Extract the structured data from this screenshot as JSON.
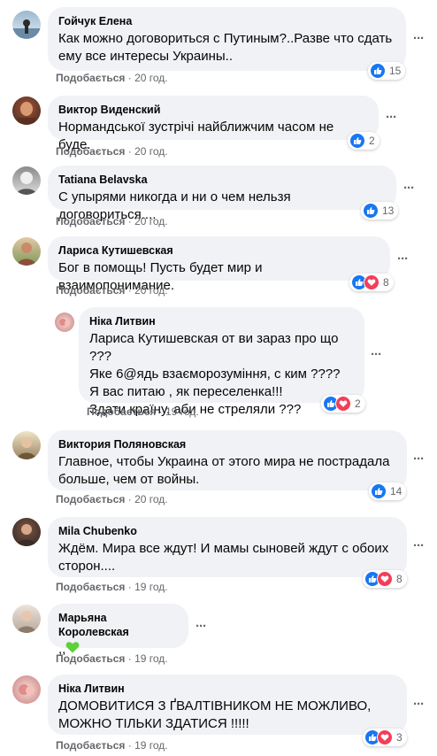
{
  "like_label": "Подобається",
  "comments": [
    {
      "author": "Гойчук Елена",
      "text": "Как можно договориться с Путиным?..Разве что сдать\nему все интересы Украины..",
      "time": "20 год.",
      "reaction_count": "15",
      "reactions": [
        "like"
      ],
      "avatar_colors": [
        "#9bb7cf",
        "#e6eef4"
      ]
    },
    {
      "author": "Виктор Виденский",
      "text": "Нормандської зустрічі найближчим часом не буде.",
      "time": "20 год.",
      "reaction_count": "2",
      "reactions": [
        "like"
      ],
      "avatar_colors": [
        "#a5523a",
        "#3c2a1c"
      ]
    },
    {
      "author": "Tatiana Belavska",
      "text": "С упырями никогда и ни о чем нельзя договориться....",
      "time": "20 год.",
      "reaction_count": "13",
      "reactions": [
        "like"
      ],
      "avatar_colors": [
        "#8a8a8a",
        "#dcdcdc"
      ]
    },
    {
      "author": "Лариса Кутишевская",
      "text": "Бог в помощь! Пусть будет мир и взаимопонимание.",
      "time": "20 год.",
      "reaction_count": "8",
      "reactions": [
        "like",
        "love"
      ],
      "avatar_colors": [
        "#c98b6a",
        "#5a7a3a"
      ]
    },
    {
      "author": "Ніка Литвин",
      "text": "Лариса Кутишевская от ви зараз про що ???\nЯке 6@ядь взаєморозуміння, с ким ????\nЯ вас питаю , як переселенка!!!\nЗдати країну, аби не стреляли ???",
      "time": "19 год.",
      "reaction_count": "2",
      "reactions": [
        "like",
        "love"
      ],
      "avatar_colors": [
        "#f2d6d0",
        "#c97d7d"
      ]
    },
    {
      "author": "Виктория Поляновская",
      "text": "Главное, чтобы Украина от этого мира не пострадала\nбольше, чем от войны.",
      "time": "20 год.",
      "reaction_count": "14",
      "reactions": [
        "like"
      ],
      "avatar_colors": [
        "#d9c9a8",
        "#7f6a4e"
      ]
    },
    {
      "author": "Mila  Chubenko",
      "text": "Ждём. Мира все ждут! И мамы сыновей ждут с обоих\nсторон....",
      "time": "19 год.",
      "reaction_count": "8",
      "reactions": [
        "like",
        "love"
      ],
      "avatar_colors": [
        "#6e4b3a",
        "#2e2420"
      ]
    },
    {
      "author": "Марьяна Королевская",
      "text": ",,",
      "heart": "💚",
      "time": "19 год.",
      "reaction_count": "",
      "reactions": [],
      "avatar_colors": [
        "#b8a89a",
        "#ece3dc"
      ]
    },
    {
      "author": "Ніка Литвин",
      "text": "ДОМОВИТИСЯ З ҐВАЛТІВНИКОМ НЕ МОЖЛИВО,\nМОЖНО ТІЛЬКИ ЗДАТИСЯ !!!!!",
      "time": "19 год.",
      "reaction_count": "3",
      "reactions": [
        "like",
        "love"
      ],
      "avatar_colors": [
        "#f2d6d0",
        "#c97d7d"
      ]
    }
  ]
}
